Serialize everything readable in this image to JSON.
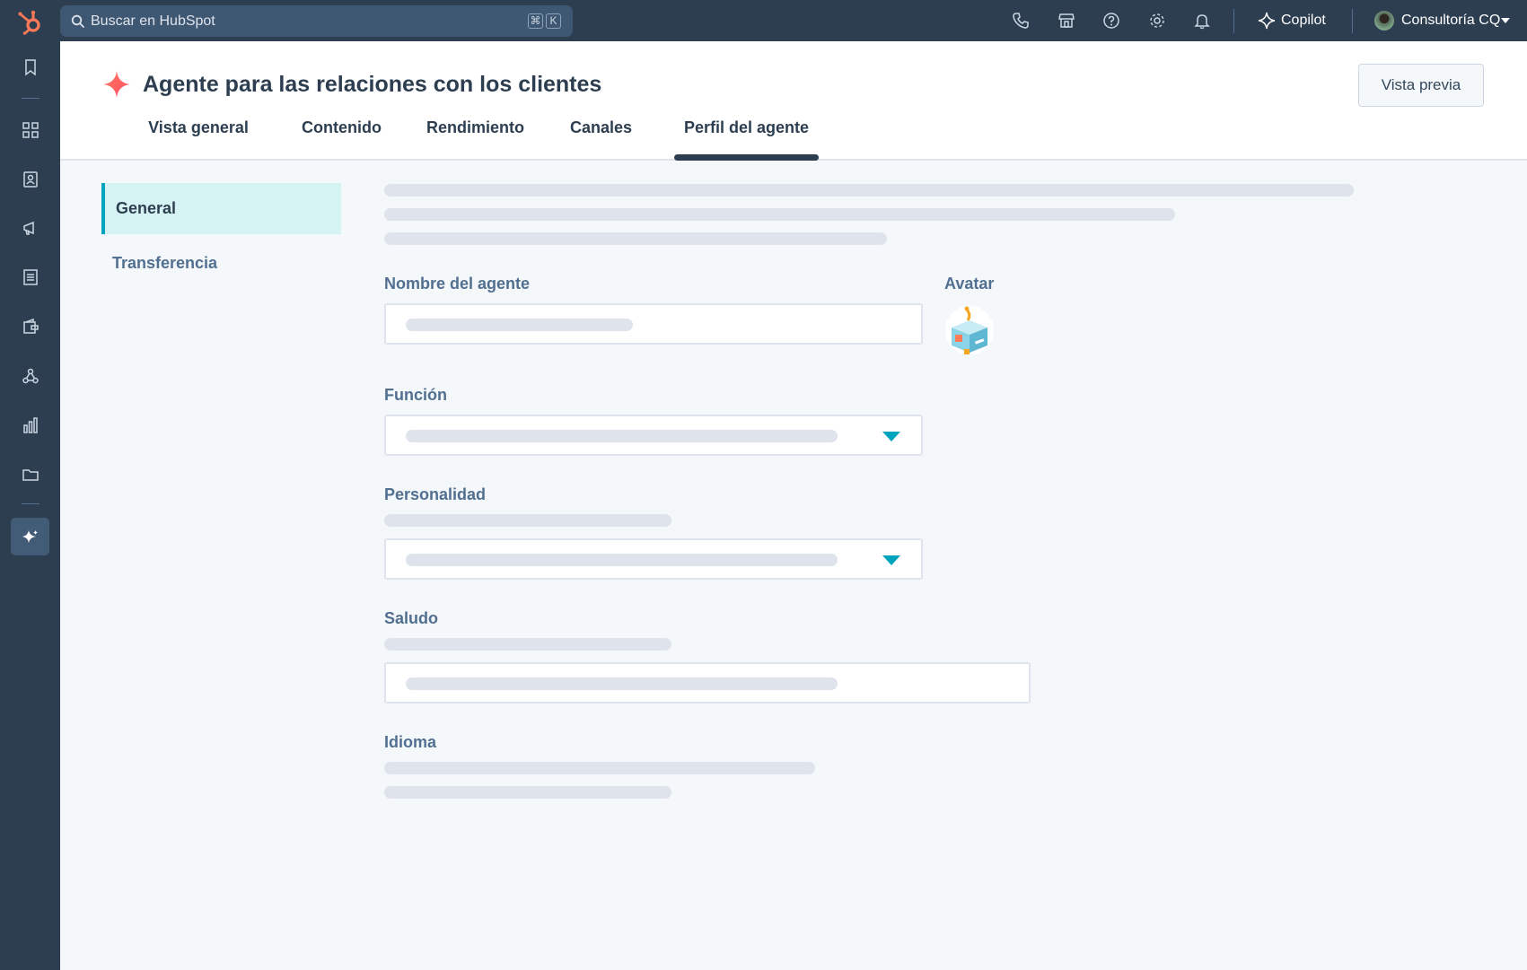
{
  "topbar": {
    "search_placeholder": "Buscar en HubSpot",
    "shortcut_keys": [
      "⌘",
      "K"
    ],
    "copilot_label": "Copilot",
    "account_name": "Consultoría CQ",
    "icons": [
      "phone-icon",
      "marketplace-icon",
      "help-icon",
      "settings-icon",
      "notifications-icon"
    ]
  },
  "leftnav": {
    "icons": [
      "bookmark-icon",
      "workspaces-icon",
      "contacts-icon",
      "marketing-icon",
      "content-icon",
      "commerce-icon",
      "automation-icon",
      "reporting-icon",
      "library-icon",
      "breeze-agents-icon"
    ],
    "active_icon": "breeze-agents-icon"
  },
  "header": {
    "title": "Agente para las relaciones con los clientes",
    "preview_button": "Vista previa",
    "tabs": [
      "Vista general",
      "Contenido",
      "Rendimiento",
      "Canales",
      "Perfil del agente"
    ],
    "active_tab": "Perfil del agente"
  },
  "subnav": {
    "items": [
      "General",
      "Transferencia"
    ],
    "active": "General"
  },
  "form": {
    "agent_name_label": "Nombre del agente",
    "avatar_label": "Avatar",
    "function_label": "Función",
    "personality_label": "Personalidad",
    "greeting_label": "Saludo",
    "language_label": "Idioma"
  },
  "colors": {
    "topbar_bg": "#2d3e50",
    "accent_teal": "#00a4bd",
    "subnav_active_bg": "#d6f3f4",
    "skeleton": "#dfe3eb",
    "hubspot_orange": "#ff7a59"
  }
}
